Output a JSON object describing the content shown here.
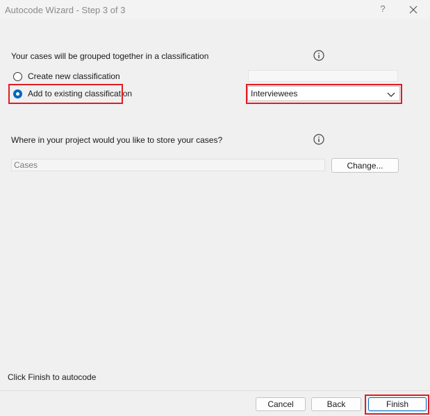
{
  "window": {
    "title": "Autocode Wizard - Step 3 of 3",
    "help_label": "?"
  },
  "classification": {
    "prompt": "Your cases will be grouped together in a classification",
    "options": [
      {
        "label": "Create new classification",
        "selected": false
      },
      {
        "label": "Add to existing classification",
        "selected": true
      }
    ],
    "selected_value": "Interviewees",
    "new_name_value": ""
  },
  "location": {
    "prompt": "Where in your project would you like to store your cases?",
    "path_value": "Cases",
    "change_label": "Change..."
  },
  "footer": {
    "hint": "Click Finish to autocode",
    "cancel_label": "Cancel",
    "back_label": "Back",
    "finish_label": "Finish"
  },
  "colors": {
    "accent": "#0067c0",
    "highlight": "#e11b22"
  }
}
